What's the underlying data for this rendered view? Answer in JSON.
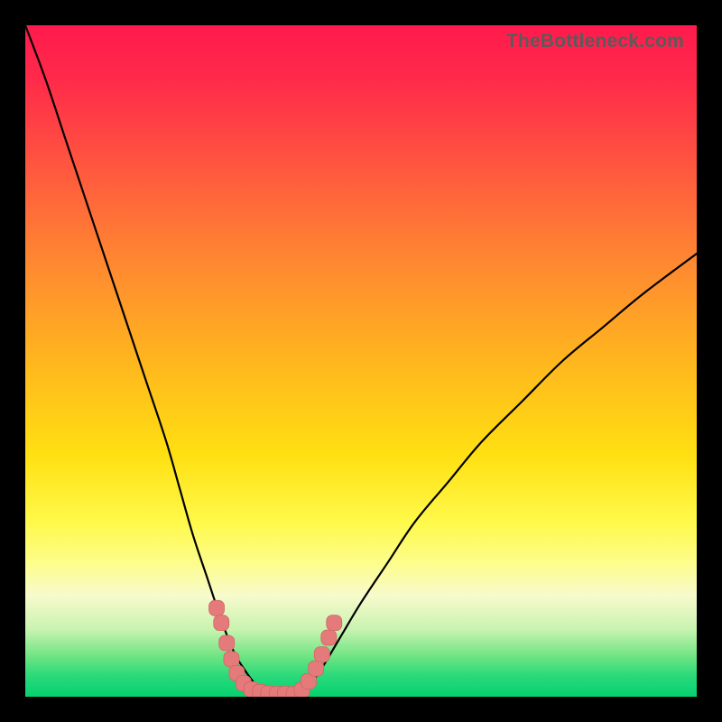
{
  "watermark": "TheBottleneck.com",
  "chart_data": {
    "type": "line",
    "title": "",
    "xlabel": "",
    "ylabel": "",
    "xlim": [
      0,
      100
    ],
    "ylim": [
      0,
      100
    ],
    "series": [
      {
        "name": "left_curve",
        "x": [
          0,
          3,
          6,
          9,
          12,
          15,
          18,
          21,
          23,
          25,
          27,
          29,
          30.5,
          32,
          35,
          38,
          40
        ],
        "values": [
          100,
          92,
          83,
          74,
          65,
          56,
          47,
          38,
          31,
          24,
          18,
          12,
          8,
          5,
          1.2,
          0.5,
          0.4
        ]
      },
      {
        "name": "right_curve",
        "x": [
          40,
          42,
          44,
          47,
          50,
          54,
          58,
          63,
          68,
          74,
          80,
          86,
          92,
          100
        ],
        "values": [
          0.4,
          1.5,
          4,
          9,
          14,
          20,
          26,
          32,
          38,
          44,
          50,
          55,
          60,
          66
        ]
      }
    ],
    "markers": {
      "name": "salmon-dots",
      "points_xy": [
        [
          28.5,
          13.2
        ],
        [
          29.2,
          11.0
        ],
        [
          30.0,
          8.0
        ],
        [
          30.7,
          5.6
        ],
        [
          31.5,
          3.5
        ],
        [
          32.5,
          2.0
        ],
        [
          33.7,
          1.1
        ],
        [
          35.0,
          0.7
        ],
        [
          36.2,
          0.5
        ],
        [
          37.5,
          0.4
        ],
        [
          38.7,
          0.4
        ],
        [
          40.0,
          0.4
        ],
        [
          41.2,
          1.0
        ],
        [
          42.2,
          2.3
        ],
        [
          43.3,
          4.2
        ],
        [
          44.2,
          6.3
        ],
        [
          45.2,
          8.8
        ],
        [
          46.0,
          11.0
        ]
      ]
    }
  }
}
